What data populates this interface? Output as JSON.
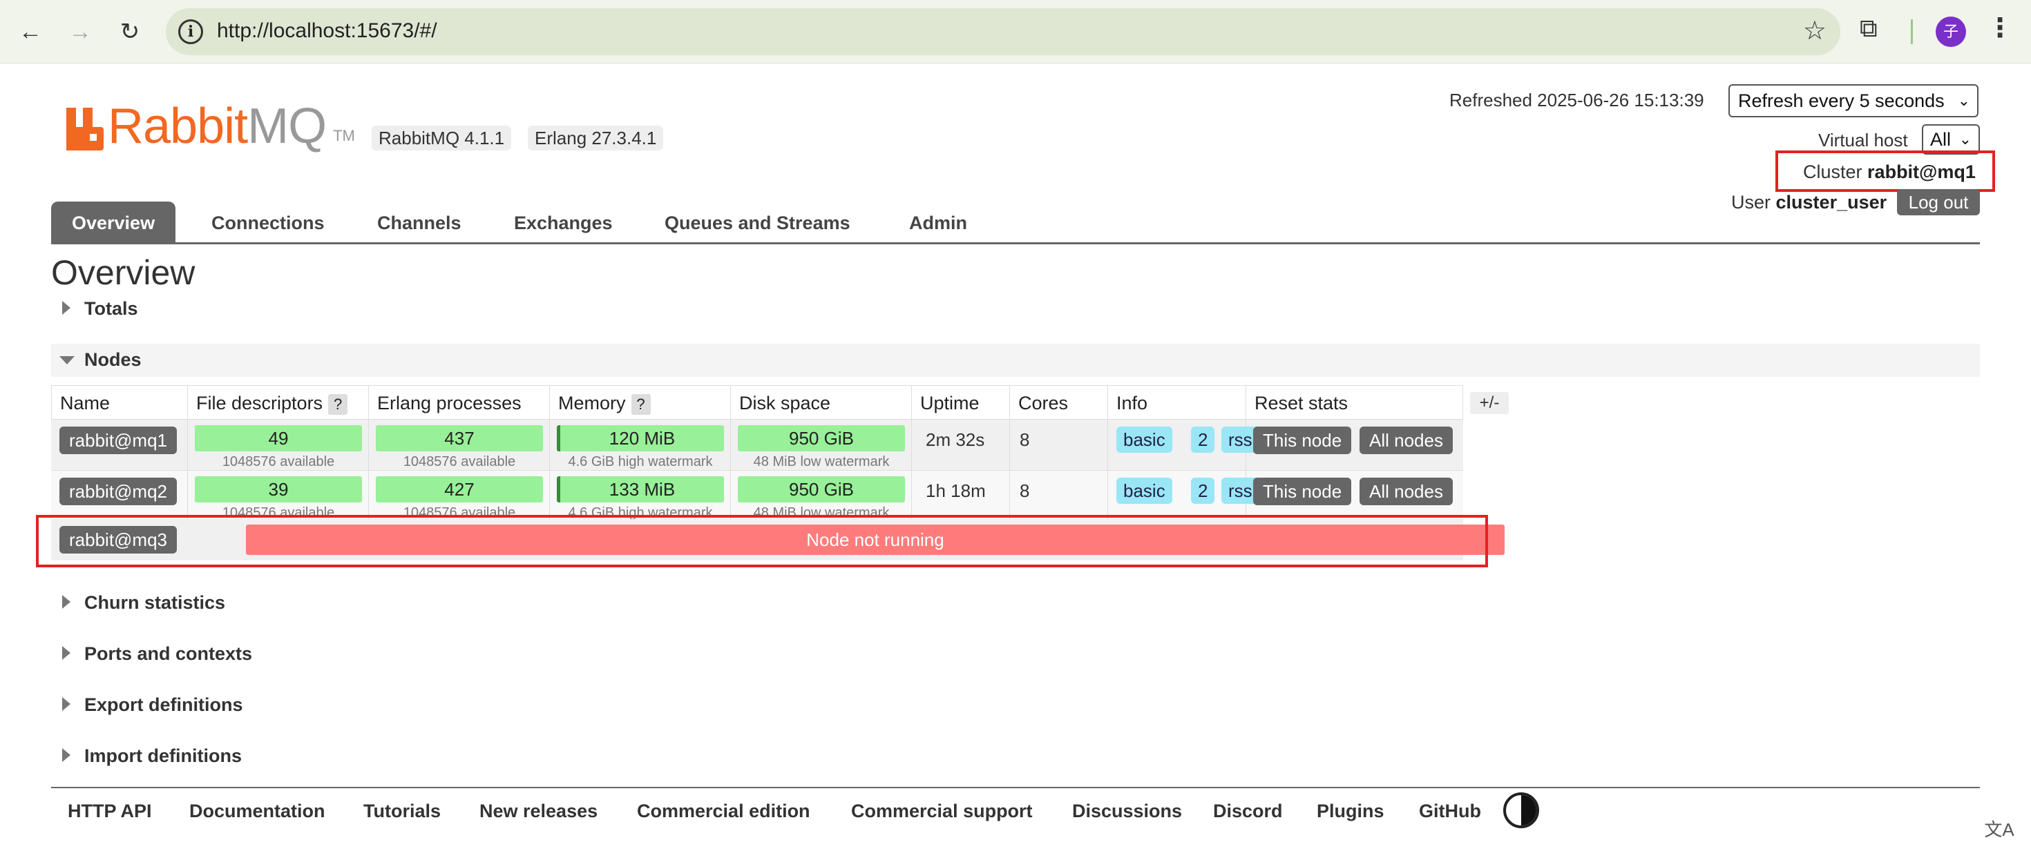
{
  "browser": {
    "url": "http://localhost:15673/#/",
    "avatar_letter": "子",
    "translate_glyph": "文A"
  },
  "header": {
    "logo_rabbit": "Rabbit",
    "logo_mq": "MQ",
    "logo_tm": "TM",
    "rabbitmq_version": "RabbitMQ 4.1.1",
    "erlang_version": "Erlang 27.3.4.1",
    "refreshed_label": "Refreshed 2025-06-26 15:13:39",
    "refresh_select": "Refresh every 5 seconds",
    "vhost_label": "Virtual host",
    "vhost_select": "All",
    "cluster_label": "Cluster",
    "cluster_name": "rabbit@mq1",
    "user_label": "User",
    "user_name": "cluster_user",
    "logout_label": "Log out"
  },
  "tabs": [
    {
      "label": "Overview"
    },
    {
      "label": "Connections"
    },
    {
      "label": "Channels"
    },
    {
      "label": "Exchanges"
    },
    {
      "label": "Queues and Streams"
    },
    {
      "label": "Admin"
    }
  ],
  "page_title": "Overview",
  "sections": {
    "totals": "Totals",
    "nodes": "Nodes",
    "churn": "Churn statistics",
    "ports": "Ports and contexts",
    "export": "Export definitions",
    "import": "Import definitions"
  },
  "nodes_table": {
    "headers": {
      "name": "Name",
      "fd": "File descriptors",
      "erl": "Erlang processes",
      "mem": "Memory",
      "disk": "Disk space",
      "uptime": "Uptime",
      "cores": "Cores",
      "info": "Info",
      "reset": "Reset stats",
      "help": "?",
      "plus_minus": "+/-"
    },
    "rows": [
      {
        "name": "rabbit@mq1",
        "fd": "49",
        "fd_sub": "1048576 available",
        "erl": "437",
        "erl_sub": "1048576 available",
        "mem": "120 MiB",
        "mem_sub": "4.6 GiB high watermark",
        "disk": "950 GiB",
        "disk_sub": "48 MiB low watermark",
        "uptime": "2m 32s",
        "cores": "8",
        "info_basic": "basic",
        "info_count": "2",
        "info_rss": "rss",
        "this_node": "This node",
        "all_nodes": "All nodes"
      },
      {
        "name": "rabbit@mq2",
        "fd": "39",
        "fd_sub": "1048576 available",
        "erl": "427",
        "erl_sub": "1048576 available",
        "mem": "133 MiB",
        "mem_sub": "4.6 GiB high watermark",
        "disk": "950 GiB",
        "disk_sub": "48 MiB low watermark",
        "uptime": "1h 18m",
        "cores": "8",
        "info_basic": "basic",
        "info_count": "2",
        "info_rss": "rss",
        "this_node": "This node",
        "all_nodes": "All nodes"
      },
      {
        "name": "rabbit@mq3",
        "status": "Node not running"
      }
    ]
  },
  "footer": {
    "links": [
      "HTTP API",
      "Documentation",
      "Tutorials",
      "New releases",
      "Commercial edition",
      "Commercial support",
      "Discussions",
      "Discord",
      "Plugins",
      "GitHub"
    ]
  },
  "colors": {
    "brand_orange": "#f26822",
    "bar_green": "#98f098",
    "down_red": "#ff7b7b",
    "info_tag": "#99e6f7",
    "highlight_red": "#e22222"
  }
}
